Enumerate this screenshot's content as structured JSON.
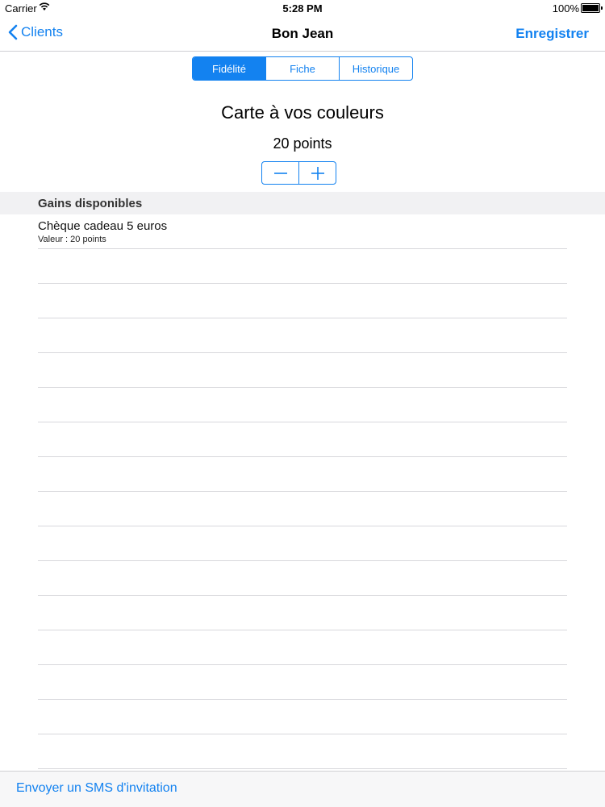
{
  "status_bar": {
    "carrier": "Carrier",
    "time": "5:28 PM",
    "battery": "100%",
    "wifi_icon": "wifi-icon",
    "battery_icon": "battery-icon"
  },
  "nav": {
    "back_label": "Clients",
    "title": "Bon Jean",
    "save_label": "Enregistrer"
  },
  "tabs": [
    {
      "label": "Fidélité",
      "active": true
    },
    {
      "label": "Fiche",
      "active": false
    },
    {
      "label": "Historique",
      "active": false
    }
  ],
  "card": {
    "title": "Carte à vos couleurs",
    "points": "20 points",
    "minus_icon": "minus-icon",
    "plus_icon": "plus-icon"
  },
  "gains": {
    "header": "Gains disponibles",
    "items": [
      {
        "name": "Chèque cadeau 5 euros",
        "value": "Valeur : 20 points"
      }
    ]
  },
  "footer": {
    "sms_label": "Envoyer un SMS d'invitation"
  },
  "colors": {
    "accent": "#1382f0",
    "section_bg": "#f1f1f3",
    "separator": "#d8d8dc"
  }
}
